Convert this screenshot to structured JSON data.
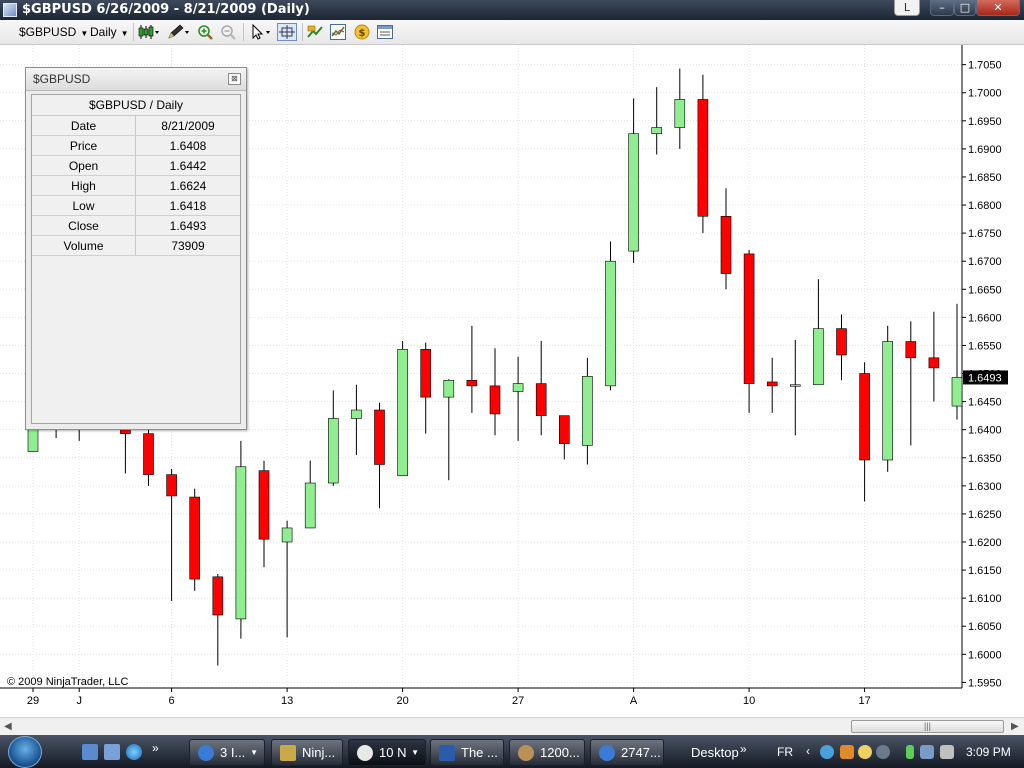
{
  "window": {
    "title": "$GBPUSD  6/26/2009 - 8/21/2009 (Daily)",
    "buttons": {
      "l": "L",
      "minimize": "–",
      "maximize": "□",
      "close": "✕"
    }
  },
  "toolbar": {
    "instrument": "$GBPUSD",
    "interval": "Daily",
    "icons": [
      "candlestick-style-icon",
      "drawing-pencil-icon",
      "zoom-in-icon",
      "zoom-out-icon",
      "pointer-icon",
      "crosshair-icon",
      "strategy-icon",
      "indicator-icon",
      "dollar-icon",
      "properties-icon"
    ]
  },
  "data_box": {
    "title": "$GBPUSD",
    "header": "$GBPUSD / Daily",
    "close_symbol": "⊠",
    "rows": [
      {
        "label": "Date",
        "value": "8/21/2009"
      },
      {
        "label": "Price",
        "value": "1.6408"
      },
      {
        "label": "Open",
        "value": "1.6442"
      },
      {
        "label": "High",
        "value": "1.6624"
      },
      {
        "label": "Low",
        "value": "1.6418"
      },
      {
        "label": "Close",
        "value": "1.6493"
      },
      {
        "label": "Volume",
        "value": "73909"
      }
    ]
  },
  "copyright": "© 2009 NinjaTrader, LLC",
  "scrollbar": {
    "left_arrow": "◀",
    "right_arrow": "▶",
    "grip": "|||"
  },
  "colors": {
    "up_candle": "#90ee90",
    "down_candle": "#ff0000",
    "grid": "#e4e4e4",
    "price_marker_bg": "#000000",
    "price_marker_text": "#ffffff"
  },
  "chart_data": {
    "type": "candlestick",
    "instrument": "$GBPUSD",
    "interval": "Daily",
    "ylim": [
      1.594,
      1.7085
    ],
    "y_ticks": [
      "1.5950",
      "1.6000",
      "1.6050",
      "1.6100",
      "1.6150",
      "1.6200",
      "1.6250",
      "1.6300",
      "1.6350",
      "1.6400",
      "1.6450",
      "1.6500",
      "1.6550",
      "1.6600",
      "1.6650",
      "1.6700",
      "1.6750",
      "1.6800",
      "1.6850",
      "1.6900",
      "1.6950",
      "1.7000",
      "1.7050"
    ],
    "x_labels": [
      {
        "label": "29",
        "bar": 0
      },
      {
        "label": "J",
        "bar": 2
      },
      {
        "label": "6",
        "bar": 6
      },
      {
        "label": "13",
        "bar": 11
      },
      {
        "label": "20",
        "bar": 16
      },
      {
        "label": "27",
        "bar": 21
      },
      {
        "label": "A",
        "bar": 26
      },
      {
        "label": "10",
        "bar": 31
      },
      {
        "label": "17",
        "bar": 36
      }
    ],
    "last_price": "1.6493",
    "candles": [
      {
        "o": 1.6361,
        "h": 1.6445,
        "l": 1.6361,
        "c": 1.6405
      },
      {
        "o": 1.642,
        "h": 1.6445,
        "l": 1.6385,
        "c": 1.641
      },
      {
        "o": 1.641,
        "h": 1.644,
        "l": 1.638,
        "c": 1.641
      },
      {
        "o": 1.641,
        "h": 1.644,
        "l": 1.64,
        "c": 1.641
      },
      {
        "o": 1.6403,
        "h": 1.644,
        "l": 1.6322,
        "c": 1.6393
      },
      {
        "o": 1.6393,
        "h": 1.64,
        "l": 1.63,
        "c": 1.632
      },
      {
        "o": 1.632,
        "h": 1.633,
        "l": 1.6095,
        "c": 1.6282
      },
      {
        "o": 1.628,
        "h": 1.6295,
        "l": 1.6113,
        "c": 1.6134
      },
      {
        "o": 1.6138,
        "h": 1.6143,
        "l": 1.598,
        "c": 1.607
      },
      {
        "o": 1.6063,
        "h": 1.638,
        "l": 1.6028,
        "c": 1.6334
      },
      {
        "o": 1.6327,
        "h": 1.6345,
        "l": 1.6155,
        "c": 1.6205
      },
      {
        "o": 1.62,
        "h": 1.6238,
        "l": 1.603,
        "c": 1.6225
      },
      {
        "o": 1.6225,
        "h": 1.6345,
        "l": 1.6225,
        "c": 1.6305
      },
      {
        "o": 1.6305,
        "h": 1.647,
        "l": 1.63,
        "c": 1.642
      },
      {
        "o": 1.642,
        "h": 1.648,
        "l": 1.6355,
        "c": 1.6435
      },
      {
        "o": 1.6435,
        "h": 1.6448,
        "l": 1.626,
        "c": 1.6338
      },
      {
        "o": 1.6318,
        "h": 1.6558,
        "l": 1.6318,
        "c": 1.6543
      },
      {
        "o": 1.6543,
        "h": 1.6555,
        "l": 1.6393,
        "c": 1.6458
      },
      {
        "o": 1.6458,
        "h": 1.649,
        "l": 1.631,
        "c": 1.6488
      },
      {
        "o": 1.6488,
        "h": 1.6585,
        "l": 1.643,
        "c": 1.6478
      },
      {
        "o": 1.6478,
        "h": 1.6545,
        "l": 1.639,
        "c": 1.6428
      },
      {
        "o": 1.6468,
        "h": 1.653,
        "l": 1.638,
        "c": 1.6482
      },
      {
        "o": 1.6482,
        "h": 1.6558,
        "l": 1.639,
        "c": 1.6425
      },
      {
        "o": 1.6425,
        "h": 1.6425,
        "l": 1.6347,
        "c": 1.6375
      },
      {
        "o": 1.6372,
        "h": 1.6528,
        "l": 1.6338,
        "c": 1.6495
      },
      {
        "o": 1.6478,
        "h": 1.6735,
        "l": 1.647,
        "c": 1.67
      },
      {
        "o": 1.6718,
        "h": 1.699,
        "l": 1.6697,
        "c": 1.6927
      },
      {
        "o": 1.6927,
        "h": 1.701,
        "l": 1.689,
        "c": 1.6938
      },
      {
        "o": 1.6938,
        "h": 1.7043,
        "l": 1.69,
        "c": 1.6988
      },
      {
        "o": 1.6988,
        "h": 1.7032,
        "l": 1.675,
        "c": 1.678
      },
      {
        "o": 1.678,
        "h": 1.683,
        "l": 1.665,
        "c": 1.6678
      },
      {
        "o": 1.6713,
        "h": 1.672,
        "l": 1.643,
        "c": 1.6482
      },
      {
        "o": 1.6485,
        "h": 1.6528,
        "l": 1.643,
        "c": 1.6478
      },
      {
        "o": 1.6478,
        "h": 1.656,
        "l": 1.639,
        "c": 1.648
      },
      {
        "o": 1.648,
        "h": 1.6668,
        "l": 1.648,
        "c": 1.658
      },
      {
        "o": 1.658,
        "h": 1.6605,
        "l": 1.6488,
        "c": 1.6533
      },
      {
        "o": 1.65,
        "h": 1.652,
        "l": 1.6272,
        "c": 1.6346
      },
      {
        "o": 1.6346,
        "h": 1.6585,
        "l": 1.6325,
        "c": 1.6557
      },
      {
        "o": 1.6557,
        "h": 1.6593,
        "l": 1.6372,
        "c": 1.6528
      },
      {
        "o": 1.6528,
        "h": 1.661,
        "l": 1.645,
        "c": 1.651
      },
      {
        "o": 1.6442,
        "h": 1.6624,
        "l": 1.6418,
        "c": 1.6493
      }
    ]
  },
  "taskbar": {
    "tasks": [
      {
        "label": "3 I...",
        "icon_color": "#3a7bd5"
      },
      {
        "label": "Ninj...",
        "icon_color": "#c9a94a"
      },
      {
        "label": "10 N",
        "icon_color": "#e8e8e8"
      },
      {
        "label": "The ...",
        "icon_color": "#2a5caa"
      },
      {
        "label": "1200...",
        "icon_color": "#b9925a"
      },
      {
        "label": "2747...",
        "icon_color": "#3a7bd5"
      }
    ],
    "desktop_label": "Desktop",
    "language": "FR",
    "chevron": "»",
    "time": "3:09 PM"
  }
}
